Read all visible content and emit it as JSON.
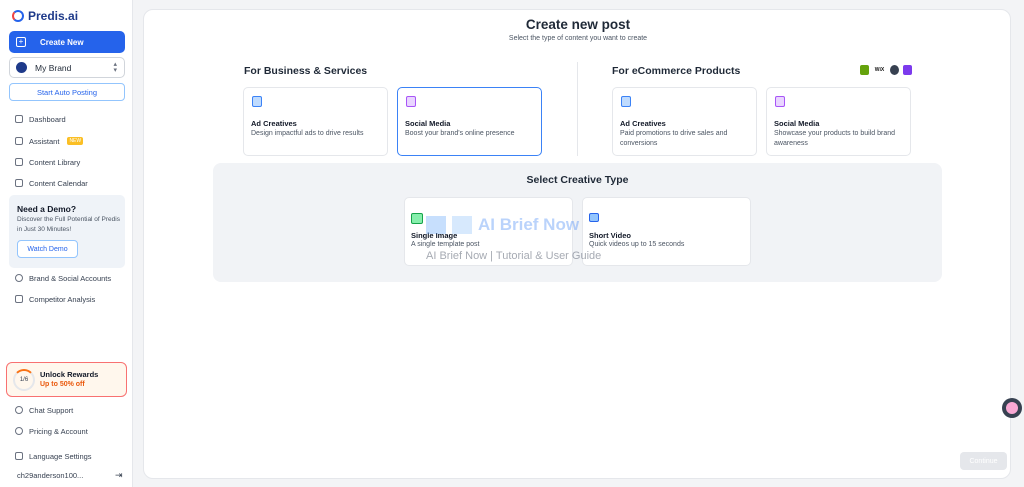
{
  "sidebar": {
    "logo_text": "Predis.ai",
    "create_new": "Create New",
    "brand": "My Brand",
    "auto_posting": "Start Auto Posting",
    "nav": [
      {
        "label": "Dashboard",
        "icon": "dashboard-icon"
      },
      {
        "label": "Assistant",
        "icon": "assistant-icon",
        "badge": "NEW"
      },
      {
        "label": "Content Library",
        "icon": "library-icon"
      },
      {
        "label": "Content Calendar",
        "icon": "calendar-icon"
      }
    ],
    "demo": {
      "title": "Need a Demo?",
      "desc": "Discover the Full Potential of Predis in Just 30 Minutes!",
      "button": "Watch Demo"
    },
    "nav2": [
      {
        "label": "Brand & Social Accounts",
        "icon": "accounts-icon"
      },
      {
        "label": "Competitor Analysis",
        "icon": "analysis-icon"
      }
    ],
    "rewards": {
      "progress": "1/6",
      "title": "Unlock Rewards",
      "subtitle": "Up to 50% off"
    },
    "footer": [
      {
        "label": "Chat Support",
        "icon": "chat-icon"
      },
      {
        "label": "Pricing & Account",
        "icon": "account-icon"
      },
      {
        "label": "Language Settings",
        "icon": "language-icon"
      }
    ],
    "user": "ch29anderson100..."
  },
  "main": {
    "title": "Create new post",
    "subtitle": "Select the type of content you want to create",
    "business": {
      "heading": "For Business & Services",
      "cards": [
        {
          "title": "Ad Creatives",
          "desc": "Design impactful ads to drive results"
        },
        {
          "title": "Social Media",
          "desc": "Boost your brand's online presence"
        }
      ]
    },
    "ecommerce": {
      "heading": "For eCommerce Products",
      "platforms": [
        "shopify-icon",
        "wix-icon",
        "squarespace-icon",
        "woocommerce-icon"
      ],
      "platform_labels": {
        "wix": "WiX"
      },
      "cards": [
        {
          "title": "Ad Creatives",
          "desc": "Paid promotions to drive sales and conversions"
        },
        {
          "title": "Social Media",
          "desc": "Showcase your products to build brand awareness"
        }
      ]
    },
    "creative": {
      "title": "Select Creative Type",
      "cards": [
        {
          "title": "Single Image",
          "desc": "A single template post"
        },
        {
          "title": "Short Video",
          "desc": "Quick videos up to 15 seconds"
        }
      ]
    },
    "continue": "Continue"
  },
  "watermark": {
    "big": "AI Brief Now",
    "small": "AI Brief Now | Tutorial & User Guide"
  },
  "colors": {
    "accent": "#2563eb",
    "selected_border": "#3b82f6",
    "rewards_border": "#f87171"
  }
}
